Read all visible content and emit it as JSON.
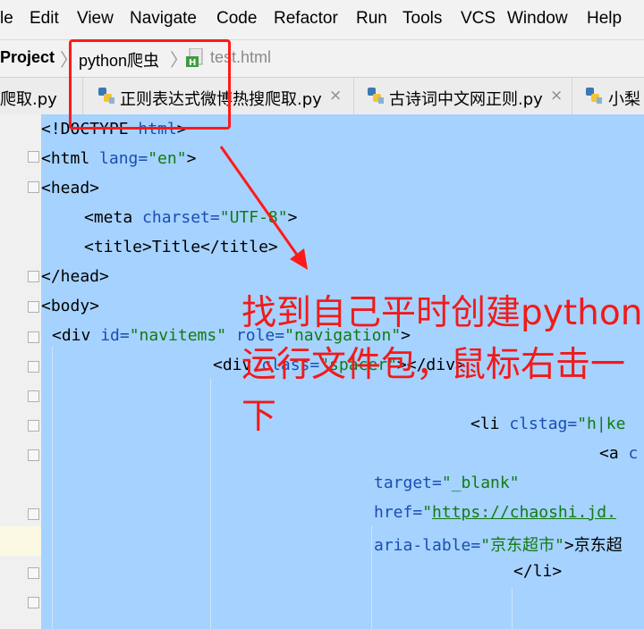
{
  "menu": [
    "le",
    "Edit",
    "View",
    "Navigate",
    "Code",
    "Refactor",
    "Run",
    "Tools",
    "VCS",
    "Window",
    "Help"
  ],
  "breadcrumb": {
    "project": "Project",
    "folder": "python爬虫",
    "file": "test.html"
  },
  "tabs": [
    {
      "label": "爬取.py"
    },
    {
      "label": "正则表达式微博热搜爬取.py",
      "close": "×"
    },
    {
      "label": "古诗词中文网正则.py",
      "close": "×"
    },
    {
      "label": "小梨"
    }
  ],
  "code": {
    "l1_doctype": "<!DOCTYPE ",
    "l1_html": "html",
    "l1_end": ">",
    "l2_open": "<html ",
    "l2_attr": "lang=",
    "l2_val": "\"en\"",
    "l2_end": ">",
    "l3": "<head>",
    "l4_open": "<meta ",
    "l4_attr": "charset=",
    "l4_val": "\"UTF-8\"",
    "l4_end": ">",
    "l5": "<title>Title</title>",
    "l6": "</head>",
    "l7": "<body>",
    "l8_open": "<div ",
    "l8_attr1": "id=",
    "l8_val1": "\"navitems\"",
    "l8_attr2": " role=",
    "l8_val2": "\"navigation\"",
    "l8_end": ">",
    "l9_open": "<div ",
    "l9_attr": "class=",
    "l9_val": "\"spacer\"",
    "l9_end": "></div>",
    "l10_open": "<li ",
    "l10_attr": "clstag=",
    "l10_val": "\"h|ke",
    "l11_open": "<a ",
    "l11_attr": "c",
    "l12_attr": "target=",
    "l12_val": "\"_blank\"",
    "l13_attr": "href=",
    "l13_q": "\"",
    "l13_url": "https://chaoshi.jd.",
    "l14_attr": "aria-lable=",
    "l14_q1": "\"",
    "l14_val": "京东超市",
    "l14_q2": "\"",
    "l14_end": ">京东超",
    "l15": "</li>"
  },
  "annotation": "找到自己平时创建python运行文件包，鼠标右击一下"
}
